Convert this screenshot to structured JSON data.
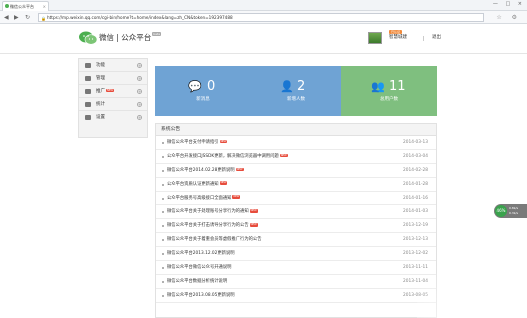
{
  "browser": {
    "tab_title": "微信公众平台",
    "tab_close": "×",
    "window_buttons": "— □ ×",
    "nav_back": "◀",
    "nav_forward": "▶",
    "nav_reload": "↻",
    "url": "https://mp.weixin.qq.com/cgi-bin/home?t=home/index&lang=zh_CN&token=192397488",
    "right_icons": "☆ ⚙"
  },
  "header": {
    "brand": "微信 | 公众平台",
    "brand_badge": "beta",
    "user_badge": "已认证",
    "user_name": "智慧城建",
    "logout": "退出"
  },
  "sidebar": {
    "items": [
      {
        "label": "功能",
        "new": ""
      },
      {
        "label": "管理",
        "new": ""
      },
      {
        "label": "推广",
        "new": "NEW"
      },
      {
        "label": "统计",
        "new": ""
      },
      {
        "label": "设置",
        "new": ""
      }
    ]
  },
  "stats": [
    {
      "value": "0",
      "label": "新消息",
      "icon": "chat-icon",
      "color": "#6fa3d4"
    },
    {
      "value": "2",
      "label": "新增人数",
      "icon": "person-icon",
      "color": "#6fa3d4"
    },
    {
      "value": "11",
      "label": "总用户数",
      "icon": "group-icon",
      "color": "#7fbf7f"
    }
  ],
  "notices": {
    "title": "系统公告",
    "items": [
      {
        "text": "微信公众平台支付申请指引",
        "new": "NEW",
        "date": "2014-03-13"
      },
      {
        "text": "公众平台开发接口JSSDK更新，解决微信浏览器中调用问题",
        "new": "NEW",
        "date": "2014-03-04"
      },
      {
        "text": "微信公众平台2014.02.28更新说明",
        "new": "NEW",
        "date": "2014-02-28"
      },
      {
        "text": "公众平台资质认证更新通知",
        "new": "NEW",
        "date": "2014-01-28"
      },
      {
        "text": "公众平台服务号高级接口全面通知",
        "new": "NEW",
        "date": "2014-01-16"
      },
      {
        "text": "微信公众平台关于处理账号分享行为的通知",
        "new": "NEW",
        "date": "2014-01-03"
      },
      {
        "text": "微信公众平台关于打击诱导分享行为的公告",
        "new": "NEW",
        "date": "2013-12-19"
      },
      {
        "text": "微信公众平台关于着重会员等虚假推广行为的公告",
        "new": "",
        "date": "2013-12-13"
      },
      {
        "text": "微信公众平台2013.12.02更新说明",
        "new": "",
        "date": "2013-12-02"
      },
      {
        "text": "微信公众平台微信公众号开通说明",
        "new": "",
        "date": "2013-11-11"
      },
      {
        "text": "微信公众平台数据分析统计说明",
        "new": "",
        "date": "2013-11-04"
      },
      {
        "text": "微信公众平台2013.08.05更新说明",
        "new": "",
        "date": "2013-08-05"
      }
    ]
  },
  "float_widget": {
    "ball": "46%",
    "line1": "0.8k/s",
    "line2": "0.3k/s"
  }
}
